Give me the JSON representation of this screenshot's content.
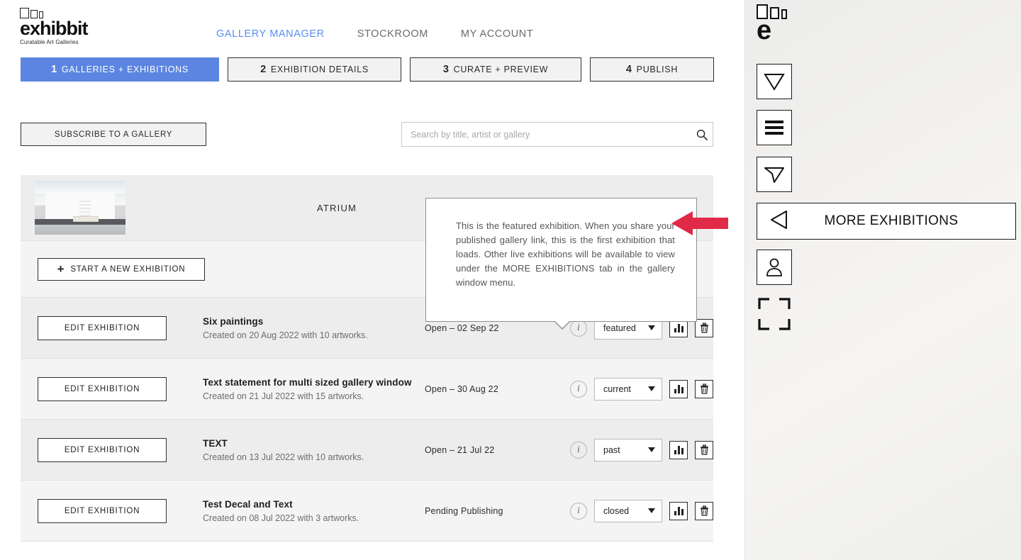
{
  "brand": {
    "name": "exhibbit",
    "tagline": "Curatable Art Galleries",
    "letter": "e"
  },
  "topnav": [
    {
      "label": "GALLERY MANAGER",
      "active": true
    },
    {
      "label": "STOCKROOM",
      "active": false
    },
    {
      "label": "MY ACCOUNT",
      "active": false
    }
  ],
  "steps": [
    {
      "num": "1",
      "label": "GALLERIES + EXHIBITIONS",
      "active": true
    },
    {
      "num": "2",
      "label": "EXHIBITION DETAILS",
      "active": false
    },
    {
      "num": "3",
      "label": "CURATE + PREVIEW",
      "active": false
    },
    {
      "num": "4",
      "label": "PUBLISH",
      "active": false
    }
  ],
  "toolbar": {
    "subscribe_label": "SUBSCRIBE TO A GALLERY",
    "search_placeholder": "Search by title, artist or gallery",
    "search_value": ""
  },
  "gallery": {
    "name": "ATRIUM",
    "thumbnail_alt": "gallery room interior with bench"
  },
  "new_exhibition": {
    "plus": "+",
    "label": "START A NEW EXHIBITION"
  },
  "exhibitions": [
    {
      "edit_label": "EDIT EXHIBITION",
      "title": "Six paintings",
      "subtitle": "Created on 20 Aug 2022 with 10 artworks.",
      "status": "Open – 02 Sep 22",
      "state": "featured"
    },
    {
      "edit_label": "EDIT EXHIBITION",
      "title": "Text statement for multi sized gallery window",
      "subtitle": "Created on 21 Jul 2022 with 15 artworks.",
      "status": "Open – 30 Aug 22",
      "state": "current"
    },
    {
      "edit_label": "EDIT EXHIBITION",
      "title": "TEXT",
      "subtitle": "Created on 13 Jul 2022 with 10 artworks.",
      "status": "Open – 21 Jul 22",
      "state": "past"
    },
    {
      "edit_label": "EDIT EXHIBITION",
      "title": "Test Decal and Text",
      "subtitle": "Created on 08 Jul 2022 with 3 artworks.",
      "status": "Pending Publishing",
      "state": "closed"
    }
  ],
  "tooltip": {
    "text": "This is the featured exhibition. When you share your published gallery link, this is the first exhibition that loads. Other live exhibitions will be available to view under the MORE EXHIBITIONS tab in the gallery window menu."
  },
  "gallery_panel": {
    "more_exhibitions_label": "MORE EXHIBITIONS",
    "buttons": [
      "down-triangle",
      "menu",
      "navigate",
      "account",
      "fullscreen"
    ]
  },
  "colors": {
    "accent_blue": "#5b85e0",
    "nav_blue": "#5b8def",
    "arrow_red": "#e02a47",
    "row_dark": "#ededed",
    "row_light": "#f4f4f4"
  }
}
